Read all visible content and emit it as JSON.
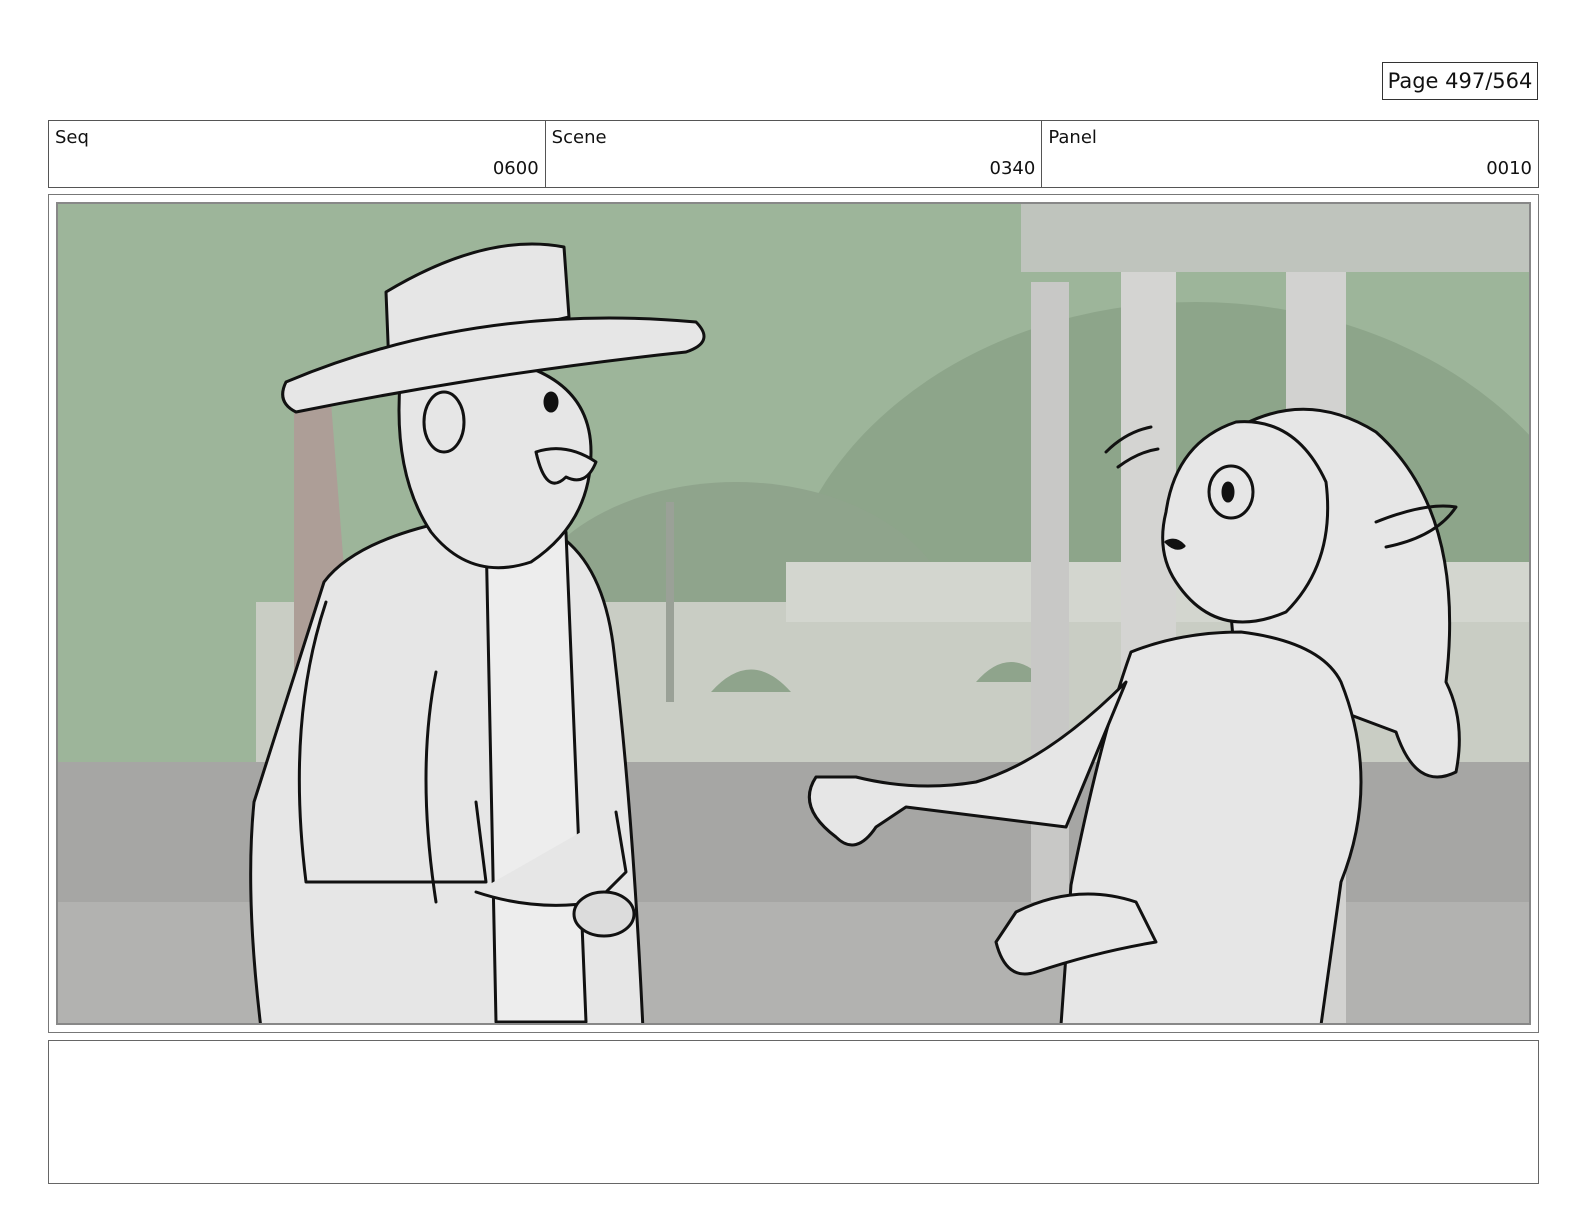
{
  "page": {
    "label": "Page 497/564"
  },
  "header": {
    "seq_label": "Seq",
    "seq_value": "0600",
    "scene_label": "Scene",
    "scene_value": "0340",
    "panel_label": "Panel",
    "panel_value": "0010"
  },
  "notes": {
    "text": ""
  },
  "colors": {
    "sky": "#9db59a",
    "wall": "#c9cdc4",
    "ground": "#a6a6a4",
    "sketch_fill": "#e6e6e6",
    "ink": "#111111"
  }
}
